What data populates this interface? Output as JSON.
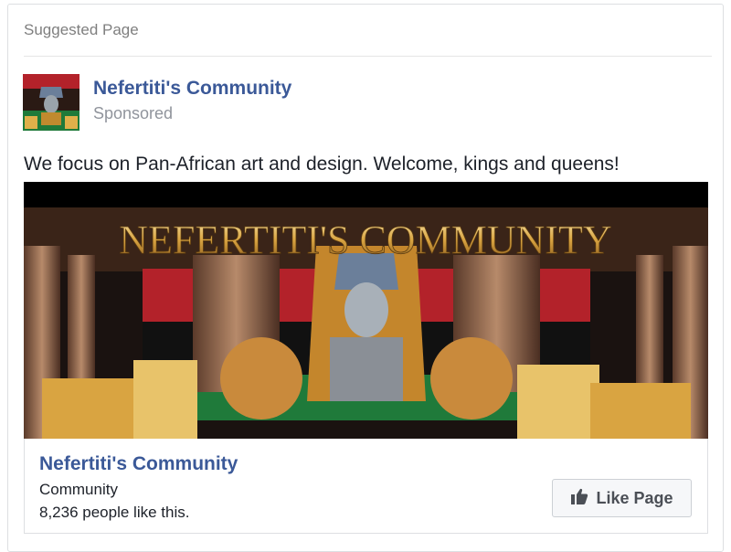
{
  "card": {
    "header": "Suggested Page",
    "page_name": "Nefertiti's Community",
    "sponsored": "Sponsored",
    "description": "We focus on Pan-African art and design. Welcome, kings and queens!"
  },
  "banner": {
    "title": "NEFERTITI'S COMMUNITY"
  },
  "footer": {
    "page_name": "Nefertiti's Community",
    "category": "Community",
    "likes": "8,236 people like this.",
    "like_button_label": "Like Page"
  },
  "icons": {
    "like_button": "thumbs-up-icon"
  },
  "colors": {
    "link": "#3b5998",
    "muted": "#90949c",
    "text": "#1d2129",
    "button_bg": "#f6f7f9",
    "flag_red": "#b3222a",
    "flag_black": "#111111",
    "flag_green": "#1f7a3a",
    "gold": "#d9a441"
  }
}
